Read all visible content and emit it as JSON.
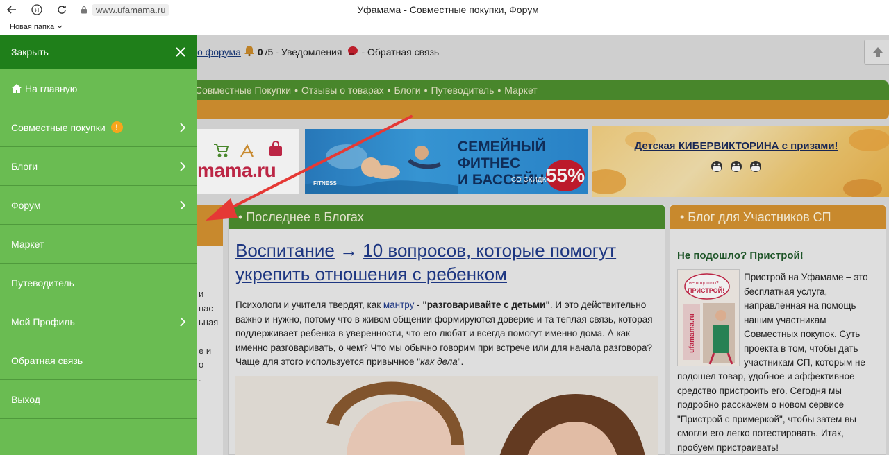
{
  "browser": {
    "url": "www.ufamama.ru",
    "title": "Уфамама - Совместные покупки, Форум",
    "bookmark_folder": "Новая папка"
  },
  "topbar": {
    "forum_link": "о форума",
    "notif_count": "0",
    "notif_total": "/5",
    "notif_label": "- Уведомления",
    "feedback": "- Обратная связь"
  },
  "greenbar": {
    "items": [
      "Совместные Покупки",
      "Отзывы о товарах",
      "Блоги",
      "Путеводитель",
      "Маркет"
    ]
  },
  "banners": {
    "logo_text": "mama.ru",
    "fitness_title_1": "СЕМЕЙНЫЙ ФИТНЕС",
    "fitness_title_2": "И БАССЕЙН",
    "fitness_small": "СО СКИДКОЙ",
    "fitness_discount": "55%",
    "fitness_brand": "FITNESS",
    "kids_link": "Детская КИБЕРВИКТОРИНА с призами!"
  },
  "left_fragments": [
    "и",
    "нас",
    "ьная",
    "е и",
    "о",
    "."
  ],
  "middle": {
    "header": "• Последнее в Блогах",
    "title_part1": "Воспитание",
    "title_arrow": " → ",
    "title_part2": "10 вопросов, которые помогут укрепить отношения с ребенком",
    "body_1": "Психологи и учителя твердят, как",
    "body_link": " мантру",
    "body_2": " - ",
    "body_bold": "\"разговаривайте с детьми\"",
    "body_3": ". И это действительно важно и нужно, потому что в живом общении формируются доверие и та теплая связь, которая поддерживает ребенка в уверенности, что его любят и всегда помогут именно дома. А как именно разговаривать, о чем? Что мы обычно говорим при встрече или для начала разговора? Чаще для этого используется привычное \"",
    "body_italic": "как дела",
    "body_4": "\"."
  },
  "right": {
    "header": "• Блог для Участников СП",
    "subtitle": "Не подошло? Пристрой!",
    "img_bubble_1": "не подошло?",
    "img_bubble_2": "ПРИСТРОЙ!",
    "img_vertical": "ufamama.ru",
    "text_1": "Пристрой на Уфамаме – это бесплатная услуга, направленная на помощь нашим участникам Совместных покупок. Суть проекта  в том, чтобы дать участникам СП, которым не",
    "text_2": "подошел товар, удобное и эффективное средство пристроить его. Сегодня мы  подробно расскажем о новом сервисе \"Пристрой с примеркой\", чтобы затем вы смогли его легко потестировать. Итак, пробуем пристраивать!"
  },
  "drawer": {
    "close_label": "Закрыть",
    "items": [
      {
        "label": "На главную",
        "has_home_icon": true,
        "has_chevron": false
      },
      {
        "label": "Совместные покупки",
        "badge": "!",
        "has_chevron": true
      },
      {
        "label": "Блоги",
        "has_chevron": true
      },
      {
        "label": "Форум",
        "has_chevron": true
      },
      {
        "label": "Маркет",
        "has_chevron": false
      },
      {
        "label": "Путеводитель",
        "has_chevron": false
      },
      {
        "label": "Мой Профиль",
        "has_chevron": true
      },
      {
        "label": "Обратная связь",
        "has_chevron": false
      },
      {
        "label": "Выход",
        "has_chevron": false
      }
    ]
  },
  "colors": {
    "drawer_bg": "#6abc52",
    "drawer_head": "#1f7f1a",
    "site_green": "#4d8f2e",
    "site_orange": "#d59230",
    "annotation_red": "#e53935"
  }
}
